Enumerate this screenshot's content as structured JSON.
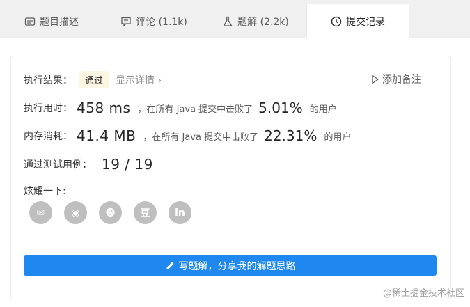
{
  "tabs": [
    {
      "label": "题目描述",
      "icon": "description-icon"
    },
    {
      "label": "评论 (1.1k)",
      "icon": "comment-icon"
    },
    {
      "label": "题解 (2.2k)",
      "icon": "flask-icon"
    },
    {
      "label": "提交记录",
      "icon": "clock-icon"
    }
  ],
  "result": {
    "label": "执行结果：",
    "status": "通过",
    "detail_link": "显示详情 ›",
    "add_note": "添加备注"
  },
  "runtime": {
    "label": "执行用时：",
    "value": "458 ms",
    "text": "，在所有 Java 提交中击败了",
    "percent": "5.01%",
    "suffix": "的用户"
  },
  "memory": {
    "label": "内存消耗：",
    "value": "41.4 MB",
    "text": "，在所有 Java 提交中击败了",
    "percent": "22.31%",
    "suffix": "的用户"
  },
  "testcases": {
    "label": "通过测试用例：",
    "value": "19 / 19"
  },
  "share": {
    "label": "炫耀一下:",
    "items": [
      {
        "icon": "wechat-icon",
        "glyph": "✉"
      },
      {
        "icon": "weibo-icon",
        "glyph": "◉"
      },
      {
        "icon": "qq-icon",
        "glyph": "☻"
      },
      {
        "icon": "douban-icon",
        "glyph": "豆"
      },
      {
        "icon": "linkedin-icon",
        "glyph": "in"
      }
    ]
  },
  "write_button": "写题解，分享我的解题思路",
  "watermark": "@稀土掘金技术社区",
  "colors": {
    "accent": "#1e88f0",
    "badge_bg": "#fdf6e3",
    "icon_gray": "#bfbfbf"
  }
}
